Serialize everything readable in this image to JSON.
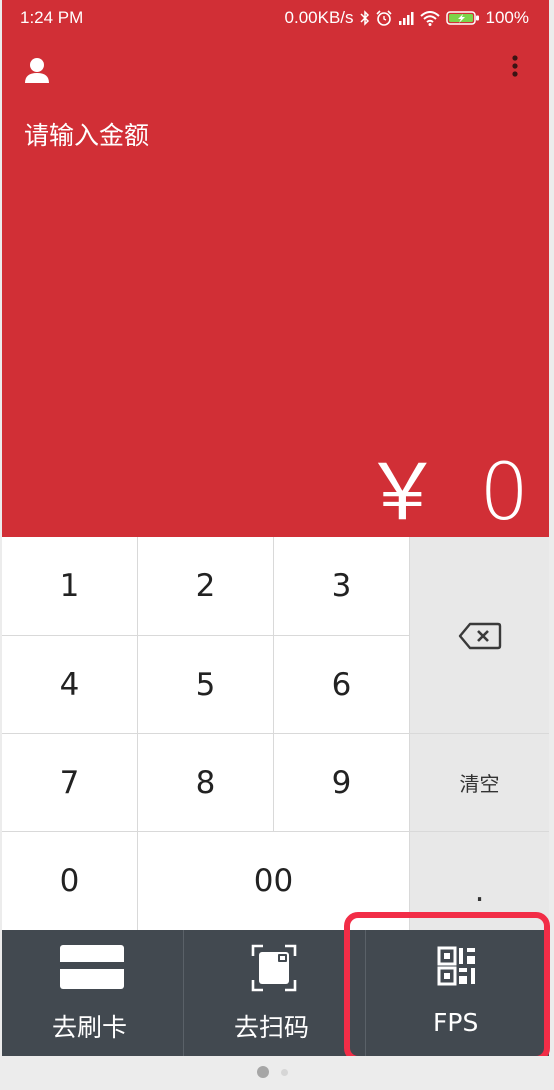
{
  "status_bar": {
    "time": "1:24 PM",
    "network_speed": "0.00KB/s",
    "battery": "100%",
    "icons": [
      "bluetooth-icon",
      "alarm-icon",
      "signal-icon",
      "wifi-icon",
      "battery-charging-icon"
    ]
  },
  "header": {
    "prompt": "请输入金额",
    "currency_symbol": "￥",
    "amount": "0",
    "background_color": "#d12f36"
  },
  "keypad": {
    "keys": [
      "1",
      "2",
      "3",
      "4",
      "5",
      "6",
      "7",
      "8",
      "9",
      "0",
      "00"
    ],
    "clear_label": "清空",
    "decimal_label": "."
  },
  "bottom_bar": {
    "tabs": [
      {
        "label": "去刷卡",
        "icon": "card-icon"
      },
      {
        "label": "去扫码",
        "icon": "scan-icon"
      },
      {
        "label": "FPS",
        "icon": "qr-code-icon"
      }
    ],
    "background_color": "#424950"
  },
  "highlight_color": "#f22d47"
}
